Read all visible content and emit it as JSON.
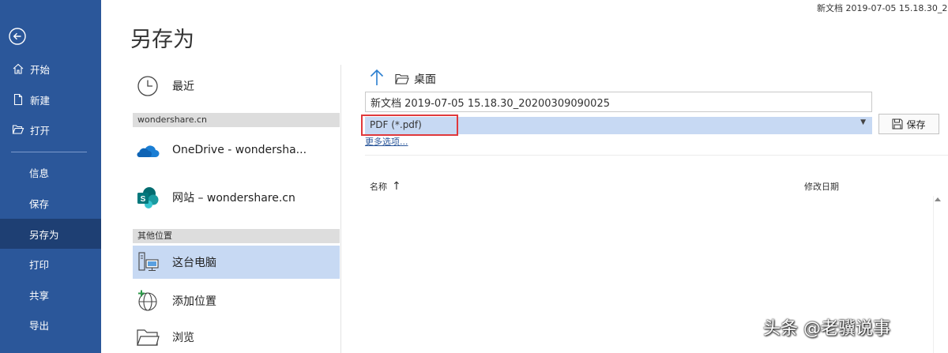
{
  "window": {
    "doc_title": "新文档 2019-07-05 15.18.30_2020"
  },
  "nav": {
    "items": [
      {
        "label": "开始",
        "icon": "home-icon"
      },
      {
        "label": "新建",
        "icon": "new-doc-icon"
      },
      {
        "label": "打开",
        "icon": "open-folder-icon"
      },
      {
        "label": "信息"
      },
      {
        "label": "保存"
      },
      {
        "label": "另存为",
        "active": true
      },
      {
        "label": "打印"
      },
      {
        "label": "共享"
      },
      {
        "label": "导出"
      }
    ],
    "back_icon": "back-arrow-icon",
    "accent": "#2b579a",
    "active_bg": "#1e3f73"
  },
  "page_title": "另存为",
  "locations": {
    "recent": "最近",
    "section_cloud": "wondershare.cn",
    "onedrive": "OneDrive - wondersha...",
    "site": "网站 – wondershare.cn",
    "section_other": "其他位置",
    "this_pc": "这台电脑",
    "add_location": "添加位置",
    "browse": "浏览",
    "selected_bg": "#c7d9f3"
  },
  "save_panel": {
    "folder": "桌面",
    "filename": "新文档 2019-07-05 15.18.30_20200309090025",
    "filetype": "PDF (*.pdf)",
    "more_options": "更多选项...",
    "save_label": "保存",
    "highlight_color": "#e0393c"
  },
  "file_list": {
    "col_name": "名称",
    "col_date": "修改日期"
  },
  "watermark": "头条 @老骥说事"
}
